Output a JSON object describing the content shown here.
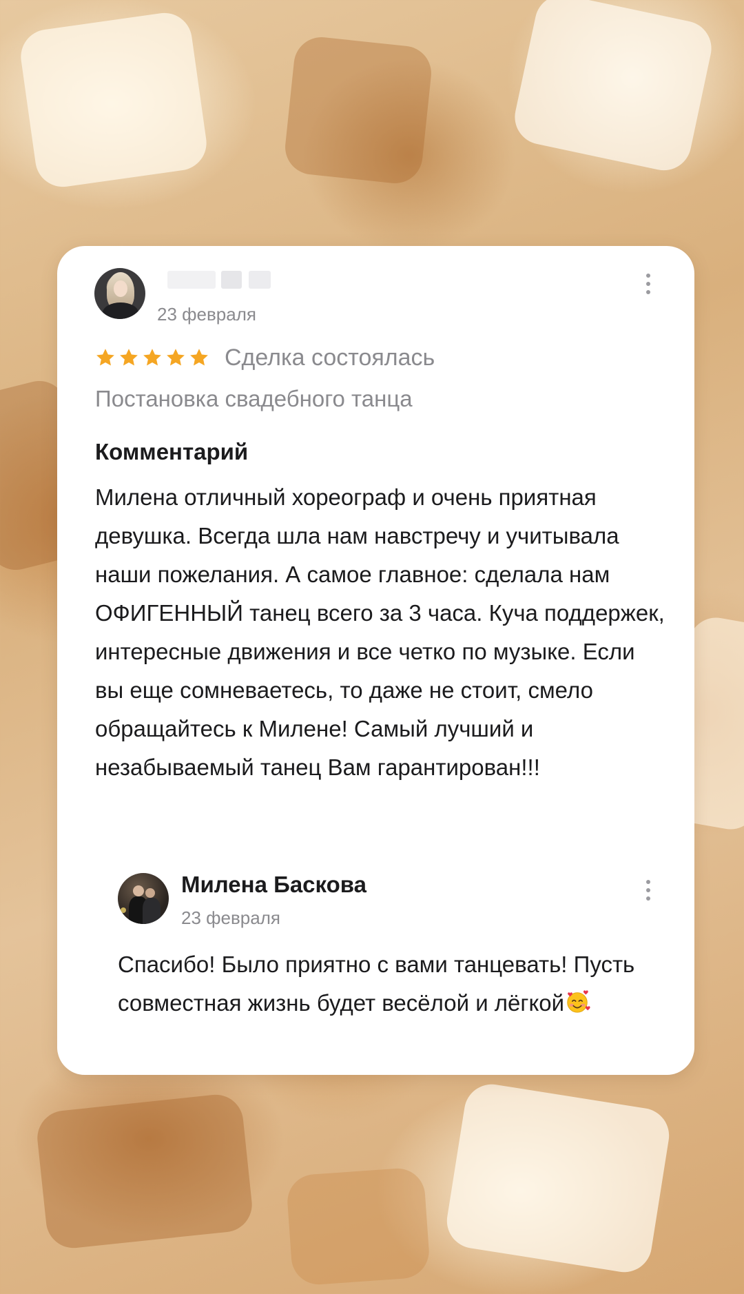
{
  "review": {
    "date": "23 февраля",
    "rating": 5,
    "rating_max": 5,
    "status": "Сделка состоялась",
    "service": "Постановка свадебного танца",
    "comment_heading": "Комментарий",
    "comment_text": "Милена отличный хореограф и очень приятная девушка. Всегда шла нам навстречу и учитывала наши пожелания. А самое главное: сделала нам ОФИГЕННЫЙ танец всего за 3 часа. Куча поддержек, интересные движения и все четко по музыке. Если вы еще сомневаетесь, то даже не стоит, смело обращайтесь к Милене! Самый лучший и незабываемый танец Вам гарантирован!!!",
    "menu_icon": "more-vertical-icon"
  },
  "reply": {
    "author": "Милена Баскова",
    "date": "23 февраля",
    "text": "Спасибо! Было приятно с вами танцевать! Пусть совместная жизнь будет весёлой и лёгкой",
    "emoji": "smiling-face-with-hearts-icon",
    "menu_icon": "more-vertical-icon"
  },
  "colors": {
    "star": "#f5a623",
    "muted_text": "#8a8a8e",
    "primary_text": "#1b1b1d",
    "card_bg": "#ffffff"
  }
}
